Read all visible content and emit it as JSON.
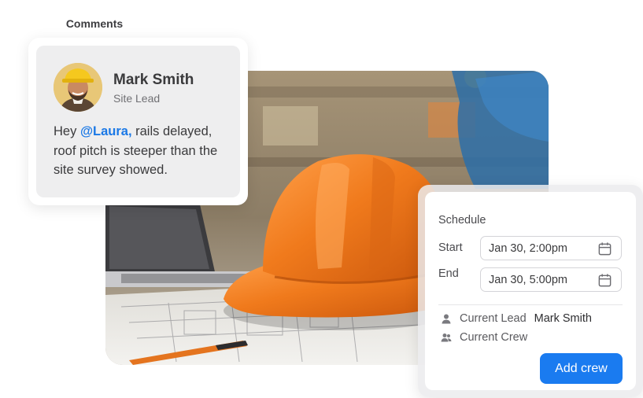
{
  "comments": {
    "tab_label": "Comments",
    "author_name": "Mark Smith",
    "author_role": "Site Lead",
    "text_prefix": "Hey ",
    "mention": "@Laura,",
    "text_suffix": " rails delayed, roof pitch is steeper than the site survey showed."
  },
  "schedule": {
    "title": "Schedule",
    "start_label": "Start",
    "start_value": "Jan 30, 2:00pm",
    "end_label": "End",
    "end_value": "Jan 30, 5:00pm",
    "current_lead_label": "Current Lead",
    "current_lead_value": "Mark Smith",
    "current_crew_label": "Current Crew",
    "add_crew_label": "Add crew"
  },
  "colors": {
    "accent": "#1a7bf0",
    "mention": "#1a78e6",
    "helmet": "#f07a1c"
  },
  "icons": {
    "calendar": "calendar-icon",
    "lead": "person-icon",
    "crew": "group-icon"
  }
}
